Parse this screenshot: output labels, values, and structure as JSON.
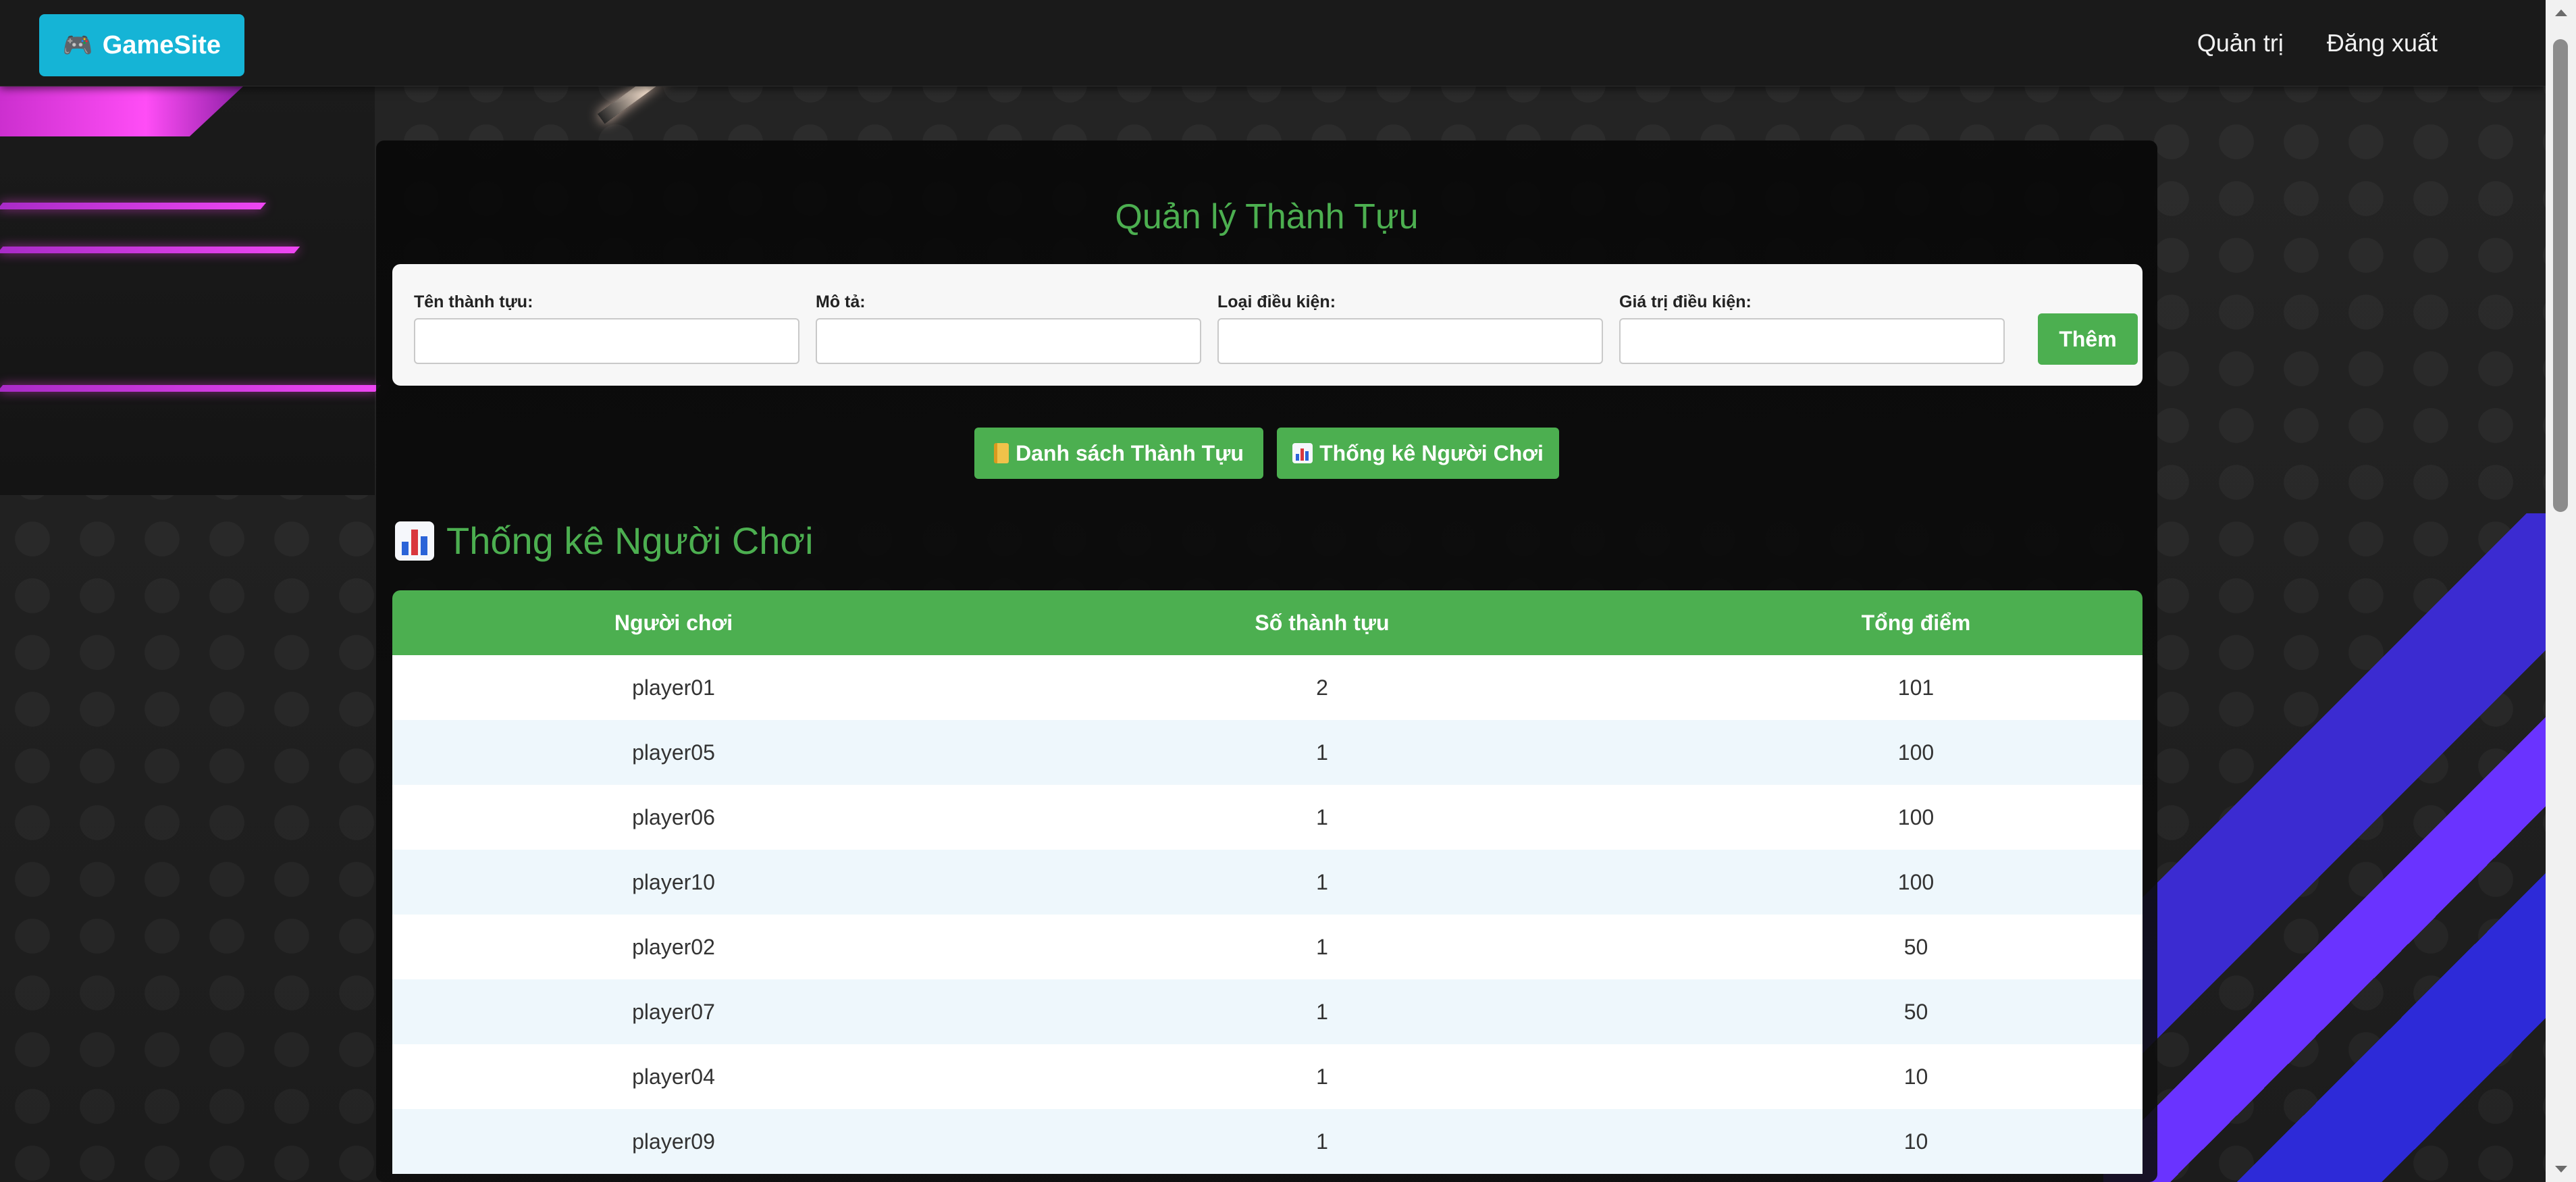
{
  "navbar": {
    "brand_label": "GameSite",
    "brand_icon": "gamepad-icon",
    "links": [
      "Quản trị",
      "Đăng xuất"
    ]
  },
  "page": {
    "title": "Quản lý Thành Tựu"
  },
  "form": {
    "fields": [
      {
        "label": "Tên thành tựu:",
        "value": ""
      },
      {
        "label": "Mô tả:",
        "value": ""
      },
      {
        "label": "Loại điều kiện:",
        "value": ""
      },
      {
        "label": "Giá trị điều kiện:",
        "value": ""
      }
    ],
    "submit_label": "Thêm"
  },
  "tabs": [
    {
      "label": "Danh sách Thành Tựu",
      "icon": "ledger-icon"
    },
    {
      "label": "Thống kê Người Chơi",
      "icon": "bar-chart-icon"
    }
  ],
  "section": {
    "title": "Thống kê Người Chơi",
    "icon": "bar-chart-icon"
  },
  "table": {
    "headers": [
      "Người chơi",
      "Số thành tựu",
      "Tổng điểm"
    ],
    "rows": [
      [
        "player01",
        "2",
        "101"
      ],
      [
        "player05",
        "1",
        "100"
      ],
      [
        "player06",
        "1",
        "100"
      ],
      [
        "player10",
        "1",
        "100"
      ],
      [
        "player02",
        "1",
        "50"
      ],
      [
        "player07",
        "1",
        "50"
      ],
      [
        "player04",
        "1",
        "10"
      ],
      [
        "player09",
        "1",
        "10"
      ]
    ]
  },
  "colors": {
    "accent_green": "#4caf50",
    "brand_cyan": "#15b4d6",
    "navbar_bg": "#1a1a1a"
  }
}
